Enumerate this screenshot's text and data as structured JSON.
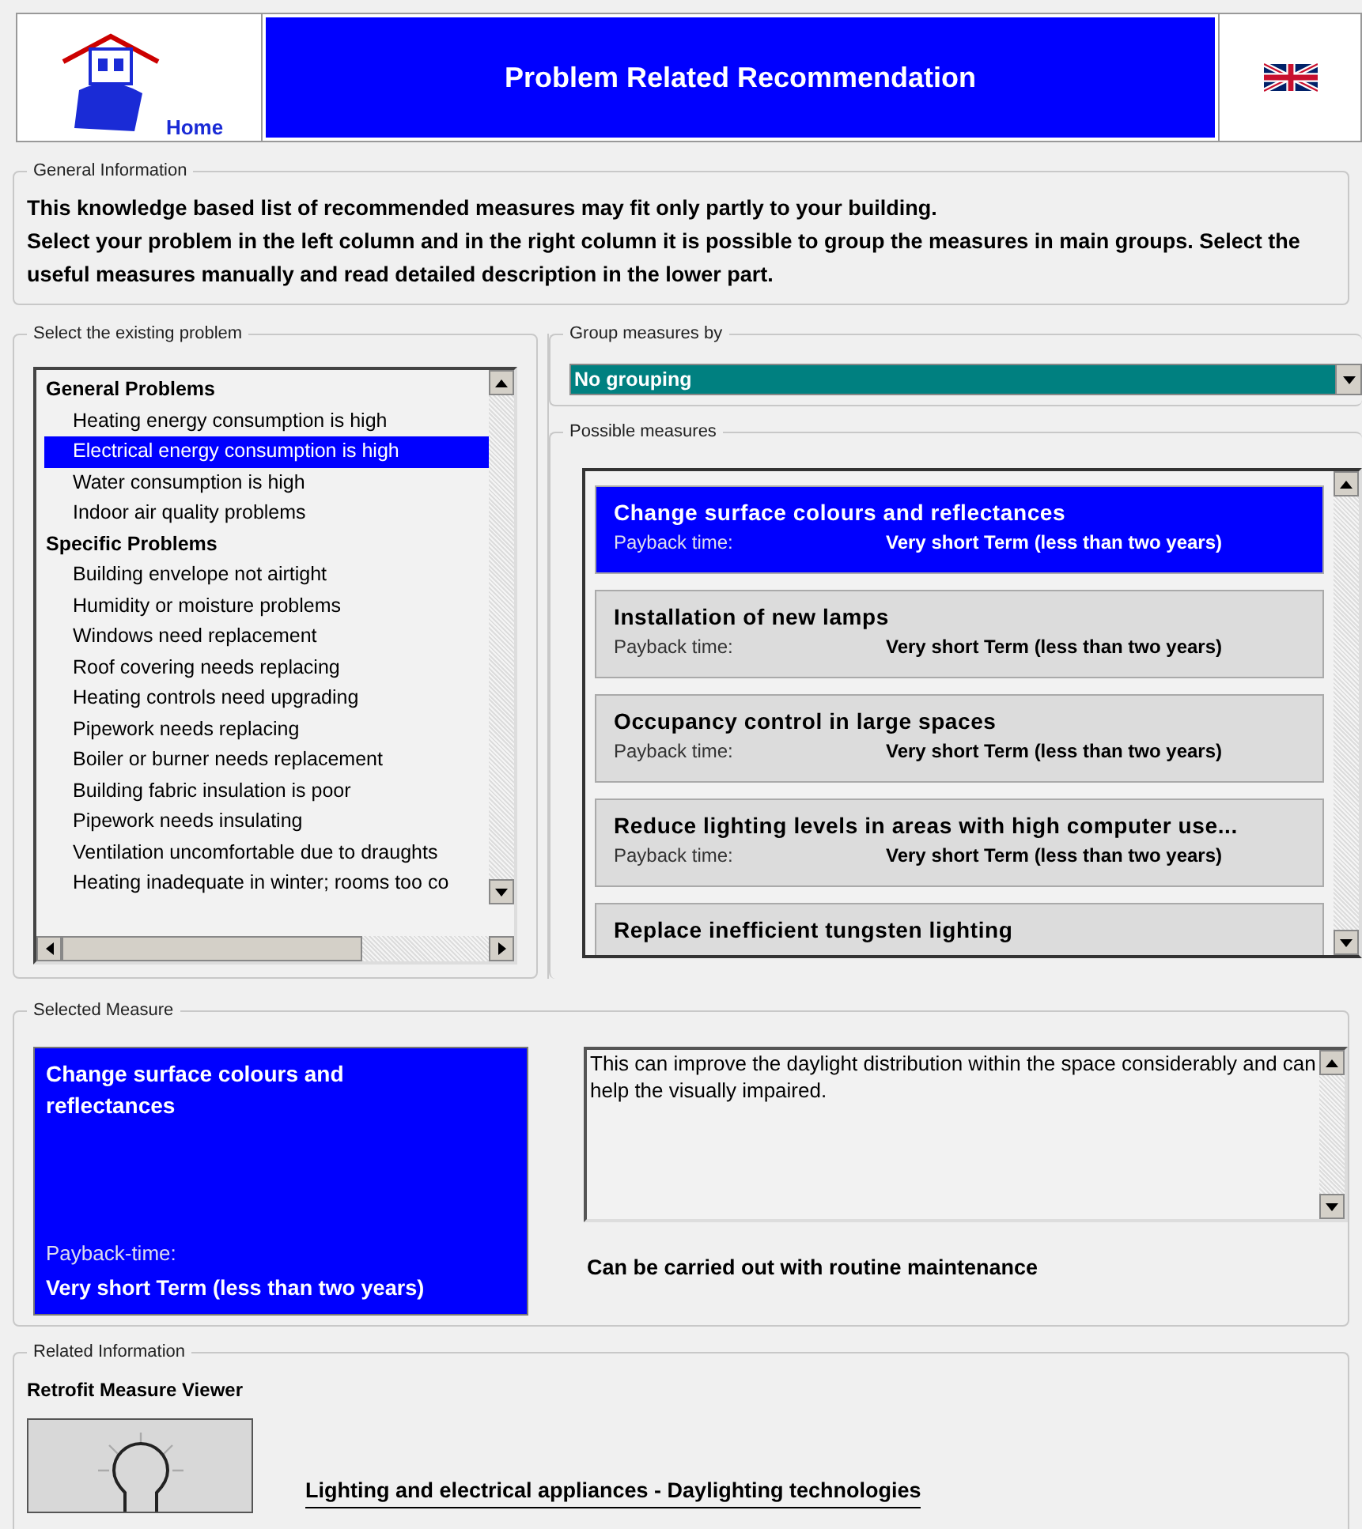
{
  "header": {
    "logo_text": "Home",
    "title": "Problem Related Recommendation"
  },
  "general_information": {
    "legend": "General Information",
    "lines": [
      "This knowledge based list of recommended measures may fit only partly to your building.",
      "Select your problem in the left column and in the right column it is possible to group the measures in main groups. Select the useful measures manually and read detailed description in the lower part."
    ]
  },
  "problems": {
    "legend": "Select the existing problem",
    "items": [
      {
        "kind": "group",
        "label": "General Problems",
        "selected": false
      },
      {
        "kind": "item",
        "label": "Heating energy consumption is high",
        "selected": false
      },
      {
        "kind": "item",
        "label": "Electrical energy consumption is high",
        "selected": true
      },
      {
        "kind": "item",
        "label": "Water consumption is high",
        "selected": false
      },
      {
        "kind": "item",
        "label": "Indoor air quality problems",
        "selected": false
      },
      {
        "kind": "group",
        "label": "Specific Problems",
        "selected": false
      },
      {
        "kind": "item",
        "label": "Building envelope not airtight",
        "selected": false
      },
      {
        "kind": "item",
        "label": "Humidity or moisture problems",
        "selected": false
      },
      {
        "kind": "item",
        "label": "Windows need replacement",
        "selected": false
      },
      {
        "kind": "item",
        "label": "Roof covering needs replacing",
        "selected": false
      },
      {
        "kind": "item",
        "label": "Heating controls need upgrading",
        "selected": false
      },
      {
        "kind": "item",
        "label": "Pipework needs replacing",
        "selected": false
      },
      {
        "kind": "item",
        "label": "Boiler or burner needs replacement",
        "selected": false
      },
      {
        "kind": "item",
        "label": "Building fabric insulation is poor",
        "selected": false
      },
      {
        "kind": "item",
        "label": "Pipework needs insulating",
        "selected": false
      },
      {
        "kind": "item",
        "label": "Ventilation uncomfortable due to draughts",
        "selected": false
      },
      {
        "kind": "item",
        "label": "Heating inadequate in winter; rooms too co",
        "selected": false
      }
    ]
  },
  "grouping": {
    "legend": "Group measures by",
    "value": "No grouping"
  },
  "measures": {
    "legend": "Possible measures",
    "items": [
      {
        "title": "Change surface colours and reflectances",
        "payback_label": "Payback time:",
        "payback": "Very short Term (less than two years)",
        "selected": true
      },
      {
        "title": "Installation of new lamps",
        "payback_label": "Payback time:",
        "payback": "Very short Term (less than two years)",
        "selected": false
      },
      {
        "title": "Occupancy control in large spaces",
        "payback_label": "Payback time:",
        "payback": "Very short Term (less than two years)",
        "selected": false
      },
      {
        "title": "Reduce lighting levels in areas with high computer use...",
        "payback_label": "Payback time:",
        "payback": "Very short Term (less than two years)",
        "selected": false
      },
      {
        "title": "Replace inefficient tungsten lighting",
        "selected": false
      }
    ]
  },
  "selected_measure": {
    "legend": "Selected Measure",
    "title": "Change surface colours and reflectances",
    "payback_label": "Payback-time:",
    "payback": "Very short Term (less than two years)",
    "description": "This can improve the daylight distribution within the space considerably and can help the visually impaired.",
    "note": "Can be carried out with routine maintenance"
  },
  "related_information": {
    "legend": "Related Information",
    "heading": "Retrofit Measure Viewer",
    "link": "Lighting and electrical appliances - Daylighting technologies"
  }
}
